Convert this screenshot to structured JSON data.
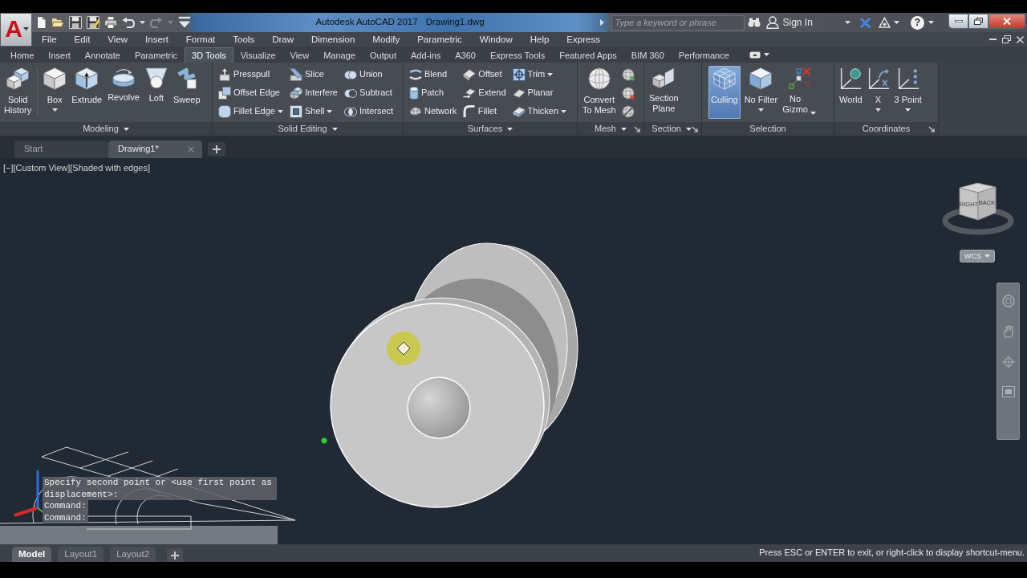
{
  "app_button": {
    "label": "A"
  },
  "quick_access": [
    {
      "disabled": false
    },
    {
      "disabled": false
    },
    {
      "disabled": false
    },
    {
      "disabled": false
    },
    {
      "disabled": false
    },
    {
      "disabled": false
    },
    {
      "disabled": true
    },
    {
      "disabled": false
    }
  ],
  "title_bar": {
    "app_name": "Autodesk AutoCAD 2017",
    "file_name": "Drawing1.dwg",
    "search": {
      "placeholder": "Type a keyword or phrase"
    },
    "sign_in": "Sign In",
    "help": "?"
  },
  "menu_bar": [
    "File",
    "Edit",
    "View",
    "Insert",
    "Format",
    "Tools",
    "Draw",
    "Dimension",
    "Modify",
    "Parametric",
    "Window",
    "Help",
    "Express"
  ],
  "ribbon_tabs": [
    {
      "label": "Home",
      "selected": false
    },
    {
      "label": "Insert",
      "selected": false
    },
    {
      "label": "Annotate",
      "selected": false
    },
    {
      "label": "Parametric",
      "selected": false
    },
    {
      "label": "3D Tools",
      "selected": true
    },
    {
      "label": "Visualize",
      "selected": false
    },
    {
      "label": "View",
      "selected": false
    },
    {
      "label": "Manage",
      "selected": false
    },
    {
      "label": "Output",
      "selected": false
    },
    {
      "label": "Add-ins",
      "selected": false
    },
    {
      "label": "A360",
      "selected": false
    },
    {
      "label": "Express Tools",
      "selected": false
    },
    {
      "label": "Featured Apps",
      "selected": false
    },
    {
      "label": "BIM 360",
      "selected": false
    },
    {
      "label": "Performance",
      "selected": false
    }
  ],
  "ribbon_panels": [
    {
      "title": "Modeling",
      "dropdown": true,
      "launcher": false,
      "groups": [
        {
          "kind": "large",
          "buttons": [
            {
              "label": "Solid\nHistory",
              "dropdown": false
            }
          ]
        },
        {
          "kind": "large",
          "buttons": [
            {
              "label": "Box",
              "dropdown": true
            },
            {
              "label": "Extrude",
              "dropdown": false
            },
            {
              "label": "Revolve",
              "dropdown": false
            },
            {
              "label": "Loft",
              "dropdown": false
            },
            {
              "label": "Sweep",
              "dropdown": false
            }
          ]
        }
      ]
    },
    {
      "title": "Solid Editing",
      "dropdown": true,
      "launcher": false,
      "groups": [
        {
          "kind": "small",
          "buttons": [
            {
              "label": "Presspull",
              "dropdown": false
            },
            {
              "label": "Offset Edge",
              "dropdown": false
            },
            {
              "label": "Fillet Edge",
              "dropdown": true
            }
          ]
        },
        {
          "kind": "small",
          "buttons": [
            {
              "label": "Slice",
              "dropdown": false
            },
            {
              "label": "Interfere",
              "dropdown": false
            },
            {
              "label": "Shell",
              "dropdown": true
            }
          ]
        },
        {
          "kind": "small",
          "buttons": [
            {
              "label": "Union",
              "dropdown": false
            },
            {
              "label": "Subtract",
              "dropdown": false
            },
            {
              "label": "Intersect",
              "dropdown": false
            }
          ]
        }
      ]
    },
    {
      "title": "Surfaces",
      "dropdown": true,
      "launcher": false,
      "groups": [
        {
          "kind": "small",
          "buttons": [
            {
              "label": "Blend",
              "dropdown": false
            },
            {
              "label": "Patch",
              "dropdown": false
            },
            {
              "label": "Network",
              "dropdown": false
            }
          ]
        },
        {
          "kind": "small",
          "buttons": [
            {
              "label": "Offset",
              "dropdown": false
            },
            {
              "label": "Extend",
              "dropdown": false
            },
            {
              "label": "Fillet",
              "dropdown": false
            }
          ]
        },
        {
          "kind": "small",
          "buttons": [
            {
              "label": "Trim",
              "dropdown": true
            },
            {
              "label": "Planar",
              "dropdown": false
            },
            {
              "label": "Thicken",
              "dropdown": true
            }
          ]
        }
      ]
    },
    {
      "title": "Mesh",
      "dropdown": true,
      "launcher": true,
      "groups": [
        {
          "kind": "large",
          "buttons": [
            {
              "label": "Convert\nTo Mesh",
              "dropdown": false
            }
          ]
        },
        {
          "kind": "icons"
        }
      ]
    },
    {
      "title": "Section",
      "dropdown": true,
      "launcher": true,
      "groups": [
        {
          "kind": "large",
          "buttons": [
            {
              "label": "Section\nPlane",
              "dropdown": false
            }
          ]
        }
      ]
    },
    {
      "title": "Selection",
      "dropdown": false,
      "launcher": false,
      "groups": [
        {
          "kind": "large",
          "buttons": [
            {
              "label": "Culling",
              "dropdown": false,
              "on": true
            },
            {
              "label": "No Filter",
              "dropdown": true,
              "on": false
            },
            {
              "label": "No\nGizmo",
              "dropdown": true,
              "on": false
            }
          ]
        }
      ]
    },
    {
      "title": "Coordinates",
      "dropdown": false,
      "launcher": true,
      "groups": [
        {
          "kind": "large",
          "buttons": [
            {
              "label": "World",
              "dropdown": false
            },
            {
              "label": "X",
              "dropdown": true
            },
            {
              "label": "3 Point",
              "dropdown": true
            }
          ]
        }
      ]
    }
  ],
  "file_tabs": [
    {
      "label": "Start",
      "selected": false,
      "closable": false
    },
    {
      "label": "Drawing1*",
      "selected": true,
      "closable": true
    }
  ],
  "viewport": {
    "controls": [
      "[−]",
      "[Custom View]",
      "[Shaded with edges]"
    ],
    "view_cube": {
      "faces": [
        "RIGHT",
        "BACK"
      ]
    },
    "ucs_menu": "WCS",
    "command_history": [
      "Specify second point or <use first point as displacement>:",
      "Command:",
      "Command:"
    ]
  },
  "layout_tabs": [
    {
      "label": "Model",
      "selected": true
    },
    {
      "label": "Layout1",
      "selected": false
    },
    {
      "label": "Layout2",
      "selected": false
    }
  ],
  "status_bar": {
    "message": "Press ESC or ENTER to exit, or right-click to display shortcut-menu."
  }
}
